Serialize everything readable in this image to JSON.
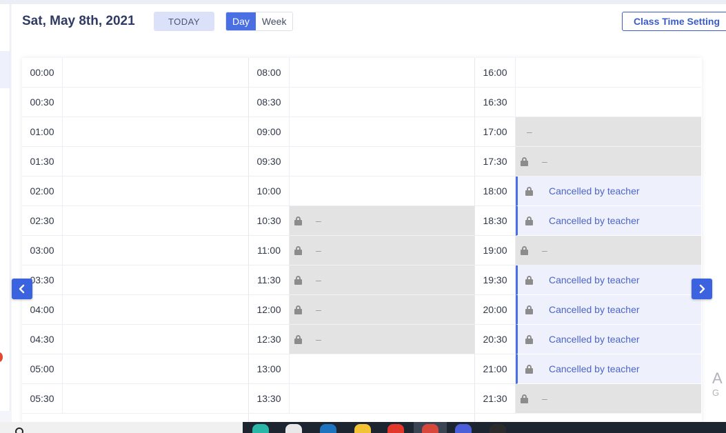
{
  "header": {
    "date_title": "Sat, May 8th, 2021",
    "today_label": "TODAY",
    "view_day": "Day",
    "view_week": "Week",
    "class_time_setting": "Class Time Setting"
  },
  "schedule": {
    "columns": [
      {
        "slots": [
          {
            "time": "00:00",
            "state": "empty"
          },
          {
            "time": "00:30",
            "state": "empty"
          },
          {
            "time": "01:00",
            "state": "empty"
          },
          {
            "time": "01:30",
            "state": "empty"
          },
          {
            "time": "02:00",
            "state": "empty"
          },
          {
            "time": "02:30",
            "state": "empty"
          },
          {
            "time": "03:00",
            "state": "empty"
          },
          {
            "time": "03:30",
            "state": "empty"
          },
          {
            "time": "04:00",
            "state": "empty"
          },
          {
            "time": "04:30",
            "state": "empty"
          },
          {
            "time": "05:00",
            "state": "empty"
          },
          {
            "time": "05:30",
            "state": "empty"
          }
        ]
      },
      {
        "slots": [
          {
            "time": "08:00",
            "state": "empty"
          },
          {
            "time": "08:30",
            "state": "empty"
          },
          {
            "time": "09:00",
            "state": "empty"
          },
          {
            "time": "09:30",
            "state": "empty"
          },
          {
            "time": "10:00",
            "state": "empty"
          },
          {
            "time": "10:30",
            "state": "locked",
            "text": "–"
          },
          {
            "time": "11:00",
            "state": "locked",
            "text": "–"
          },
          {
            "time": "11:30",
            "state": "locked",
            "text": "–"
          },
          {
            "time": "12:00",
            "state": "locked",
            "text": "–"
          },
          {
            "time": "12:30",
            "state": "locked",
            "text": "–"
          },
          {
            "time": "13:00",
            "state": "empty"
          },
          {
            "time": "13:30",
            "state": "empty"
          }
        ]
      },
      {
        "slots": [
          {
            "time": "16:00",
            "state": "empty"
          },
          {
            "time": "16:30",
            "state": "empty"
          },
          {
            "time": "17:00",
            "state": "unavailable",
            "text": "–"
          },
          {
            "time": "17:30",
            "state": "locked",
            "text": "–"
          },
          {
            "time": "18:00",
            "state": "cancelled",
            "text": "Cancelled by teacher"
          },
          {
            "time": "18:30",
            "state": "cancelled",
            "text": "Cancelled by teacher"
          },
          {
            "time": "19:00",
            "state": "locked",
            "text": "–"
          },
          {
            "time": "19:30",
            "state": "cancelled",
            "text": "Cancelled by teacher"
          },
          {
            "time": "20:00",
            "state": "cancelled",
            "text": "Cancelled by teacher"
          },
          {
            "time": "20:30",
            "state": "cancelled",
            "text": "Cancelled by teacher"
          },
          {
            "time": "21:00",
            "state": "cancelled",
            "text": "Cancelled by teacher"
          },
          {
            "time": "21:30",
            "state": "locked",
            "text": "–"
          }
        ]
      }
    ]
  },
  "navigation": {
    "prev_icon": "chevron-left-icon",
    "next_icon": "chevron-right-icon"
  },
  "colors": {
    "accent": "#4a6fe3",
    "cancelled_bg": "#eef1fc",
    "locked_bg": "#e3e3e3",
    "cancelled_text": "#4a64c9"
  }
}
